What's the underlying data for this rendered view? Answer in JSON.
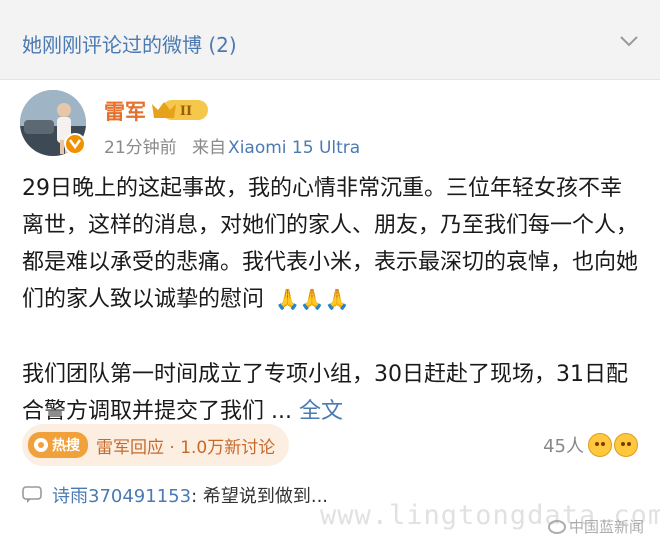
{
  "header": {
    "title": "她刚刚评论过的微博 (2)",
    "chevron_icon": "chevron-down-icon"
  },
  "post": {
    "author": "雷军",
    "crown_level": "II",
    "time": "21分钟前",
    "source_prefix": "来自",
    "device": "Xiaomi 15 Ultra",
    "paragraph1": "29日晚上的这起事故，我的心情非常沉重。三位年轻女孩不幸离世，这样的消息，对她们的家人、朋友，乃至我们每一个人，都是难以承受的悲痛。我代表小米，表示最深切的哀悼，也向她们的家人致以诚挚的慰问",
    "pray_emojis": "🙏🙏🙏",
    "paragraph2": "我们团队第一时间成立了专项小组，30日赶赴了现场，31日配合警方调取并提交了我们 ... ",
    "full_text_link": "全文"
  },
  "hot_topic": {
    "badge": "热搜",
    "text": "雷军回应 · 1.0万新讨论"
  },
  "reactions": {
    "count": "45人"
  },
  "comment": {
    "username": "诗雨370491153",
    "text": ": 希望说到做到..."
  },
  "watermark": {
    "site": "www.lingtongdata.com",
    "source": "中国蓝新闻"
  }
}
